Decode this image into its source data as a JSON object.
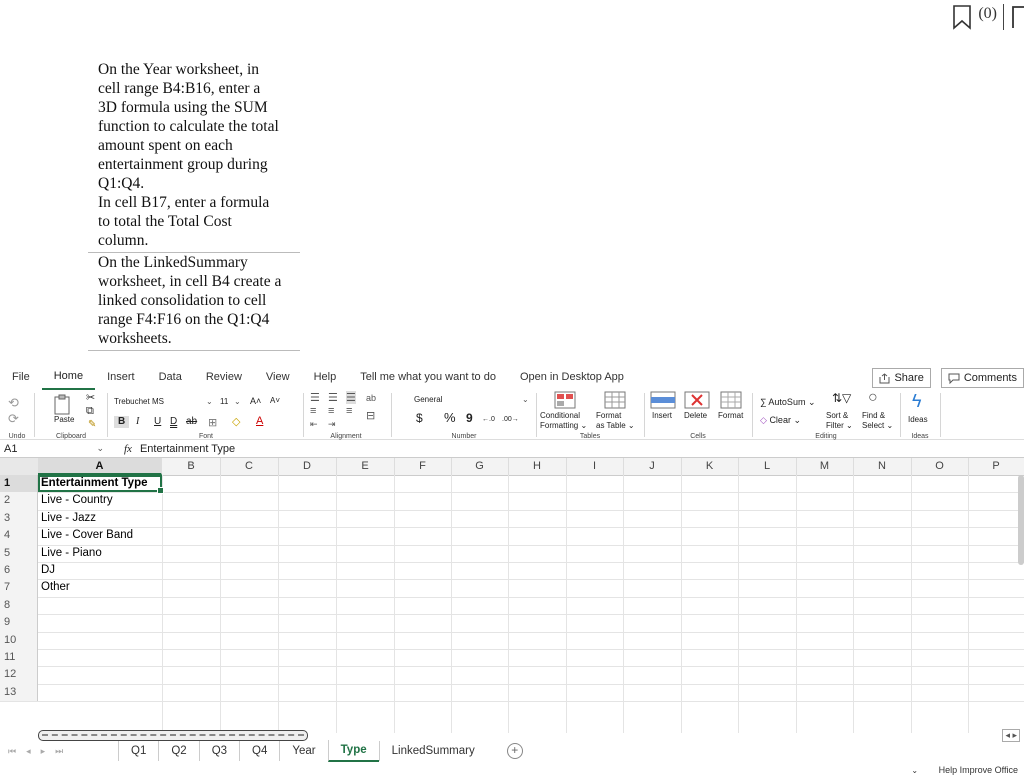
{
  "top": {
    "bookmark_count": "(0)"
  },
  "instructions": [
    {
      "lines": [
        "On the Year worksheet, in",
        "cell range B4:B16, enter a",
        "3D formula using the SUM",
        "function to calculate the total",
        "amount spent on each",
        "entertainment group during",
        "Q1:Q4.",
        "In cell B17, enter a formula",
        "to total the Total Cost",
        "column."
      ]
    },
    {
      "lines": [
        "On the LinkedSummary",
        "worksheet, in cell B4 create a",
        "linked consolidation to cell",
        "range F4:F16 on the Q1:Q4",
        "worksheets."
      ]
    }
  ],
  "menu": {
    "tabs": [
      "File",
      "Home",
      "Insert",
      "Data",
      "Review",
      "View",
      "Help"
    ],
    "tell_me": "Tell me what you want to do",
    "open_desktop": "Open in Desktop App",
    "share": "Share",
    "comments": "Comments"
  },
  "ribbon": {
    "undo": "Undo",
    "clipboard": {
      "paste": "Paste",
      "label": "Clipboard"
    },
    "font": {
      "name": "Trebuchet MS",
      "size": "11",
      "label": "Font",
      "bold": "B",
      "italic": "I",
      "underline": "U",
      "dunderline": "D",
      "strike": "ab"
    },
    "alignment": {
      "label": "Alignment"
    },
    "number": {
      "format": "General",
      "label": "Number",
      "currency": "$",
      "percent": "%",
      "comma": "9"
    },
    "tables": {
      "conditional": "Conditional",
      "formatting": "Formatting",
      "format": "Format",
      "as_table": "as Table",
      "label": "Tables"
    },
    "cells": {
      "insert": "Insert",
      "delete": "Delete",
      "format": "Format",
      "label": "Cells"
    },
    "editing": {
      "autosum": "AutoSum",
      "clear": "Clear",
      "sort1": "Sort &",
      "sort2": "Filter",
      "find1": "Find &",
      "find2": "Select",
      "label": "Editing"
    },
    "ideas": {
      "btn": "Ideas",
      "label": "Ideas"
    }
  },
  "formula_bar": {
    "cell": "A1",
    "fx": "fx",
    "value": "Entertainment Type"
  },
  "columns": [
    "A",
    "B",
    "C",
    "D",
    "E",
    "F",
    "G",
    "H",
    "I",
    "J",
    "K",
    "L",
    "M",
    "N",
    "O",
    "P"
  ],
  "rows": [
    {
      "num": "1",
      "a": "Entertainment Type"
    },
    {
      "num": "2",
      "a": "Live - Country"
    },
    {
      "num": "3",
      "a": "Live - Jazz"
    },
    {
      "num": "4",
      "a": "Live - Cover Band"
    },
    {
      "num": "5",
      "a": "Live - Piano"
    },
    {
      "num": "6",
      "a": "DJ"
    },
    {
      "num": "7",
      "a": "Other"
    },
    {
      "num": "8",
      "a": ""
    },
    {
      "num": "9",
      "a": ""
    },
    {
      "num": "10",
      "a": ""
    },
    {
      "num": "11",
      "a": ""
    },
    {
      "num": "12",
      "a": ""
    },
    {
      "num": "13",
      "a": ""
    }
  ],
  "sheets": [
    "Q1",
    "Q2",
    "Q3",
    "Q4",
    "Year",
    "Type",
    "LinkedSummary"
  ],
  "active_sheet": "Type",
  "status": {
    "help": "Help Improve Office"
  },
  "colors": {
    "accent": "#217346"
  }
}
